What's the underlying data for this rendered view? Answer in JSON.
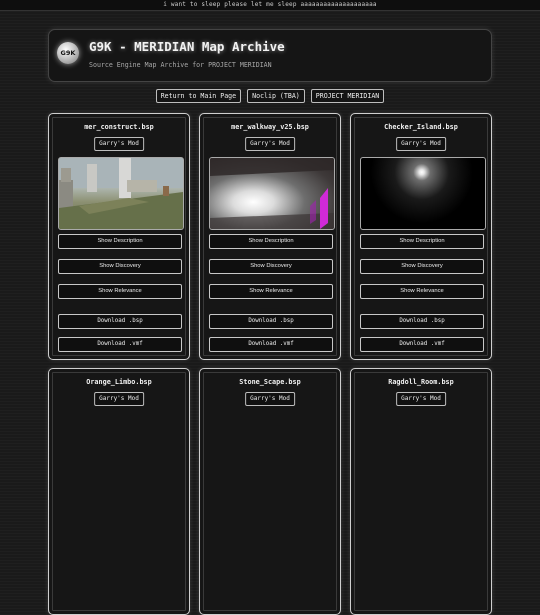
{
  "marquee": "i want to sleep please let me sleep aaaaaaaaaaaaaaaaaaaa",
  "header": {
    "logo_text": "G9K",
    "title": "G9K - MERIDIAN Map Archive",
    "subtitle": "Source Engine Map Archive for PROJECT MERIDIAN"
  },
  "nav": [
    "Return to Main Page",
    "Noclip (TBA)",
    "PROJECT MERIDIAN"
  ],
  "buttons": {
    "show_description": "Show Description",
    "show_discovery": "Show Discovery",
    "show_relevance": "Show Relevance",
    "download_bsp": "Download .bsp",
    "download_vmf": "Download .vmf"
  },
  "maps": [
    {
      "name": "mer_construct.bsp",
      "mod": "Garry's Mod"
    },
    {
      "name": "mer_walkway_v25.bsp",
      "mod": "Garry's Mod"
    },
    {
      "name": "Checker_Island.bsp",
      "mod": "Garry's Mod"
    },
    {
      "name": "Orange_Limbo.bsp",
      "mod": "Garry's Mod"
    },
    {
      "name": "Stone_Scape.bsp",
      "mod": "Garry's Mod"
    },
    {
      "name": "Ragdoll_Room.bsp",
      "mod": "Garry's Mod"
    }
  ],
  "colors": {
    "background": "#1a1a1a",
    "accent_magenta": "#d02ad8",
    "border": "#cfcfcf"
  }
}
